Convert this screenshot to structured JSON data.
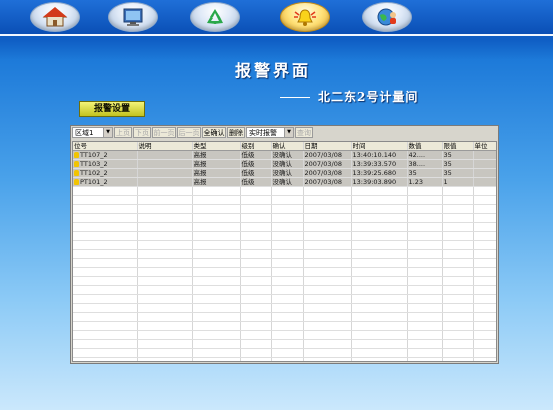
{
  "nav": [
    {
      "icon": "home-icon"
    },
    {
      "icon": "monitor-icon"
    },
    {
      "icon": "recycle-icon"
    },
    {
      "icon": "alarm-bell-icon",
      "active": true
    },
    {
      "icon": "globe-user-icon"
    }
  ],
  "header": {
    "title": "报警界面",
    "subtitle": "北二东2号计量间"
  },
  "alarm_settings_label": "报警设置",
  "toolbar": {
    "area_select": "区域1",
    "btn_top": "上页",
    "btn_bottom": "下页",
    "btn_prev": "前一页",
    "btn_next": "后一页",
    "btn_confirm_all": "全确认",
    "btn_delete": "删除",
    "mode_select": "实时报警",
    "btn_query": "查询"
  },
  "table": {
    "columns": [
      "位号",
      "说明",
      "类型",
      "级别",
      "确认",
      "日期",
      "时间",
      "数值",
      "限值",
      "单位"
    ],
    "rows": [
      [
        "TT107_2",
        "",
        "高报",
        "低级",
        "没确认",
        "2007/03/08",
        "13:40:10.140",
        "42....",
        "35",
        ""
      ],
      [
        "TT103_2",
        "",
        "高报",
        "低级",
        "没确认",
        "2007/03/08",
        "13:39:33.570",
        "38....",
        "35",
        ""
      ],
      [
        "TT102_2",
        "",
        "高报",
        "低级",
        "没确认",
        "2007/03/08",
        "13:39:25.680",
        "35",
        "35",
        ""
      ],
      [
        "PT101_2",
        "",
        "高报",
        "低级",
        "没确认",
        "2007/03/08",
        "13:39:03.890",
        "1.23",
        "1",
        ""
      ]
    ]
  }
}
